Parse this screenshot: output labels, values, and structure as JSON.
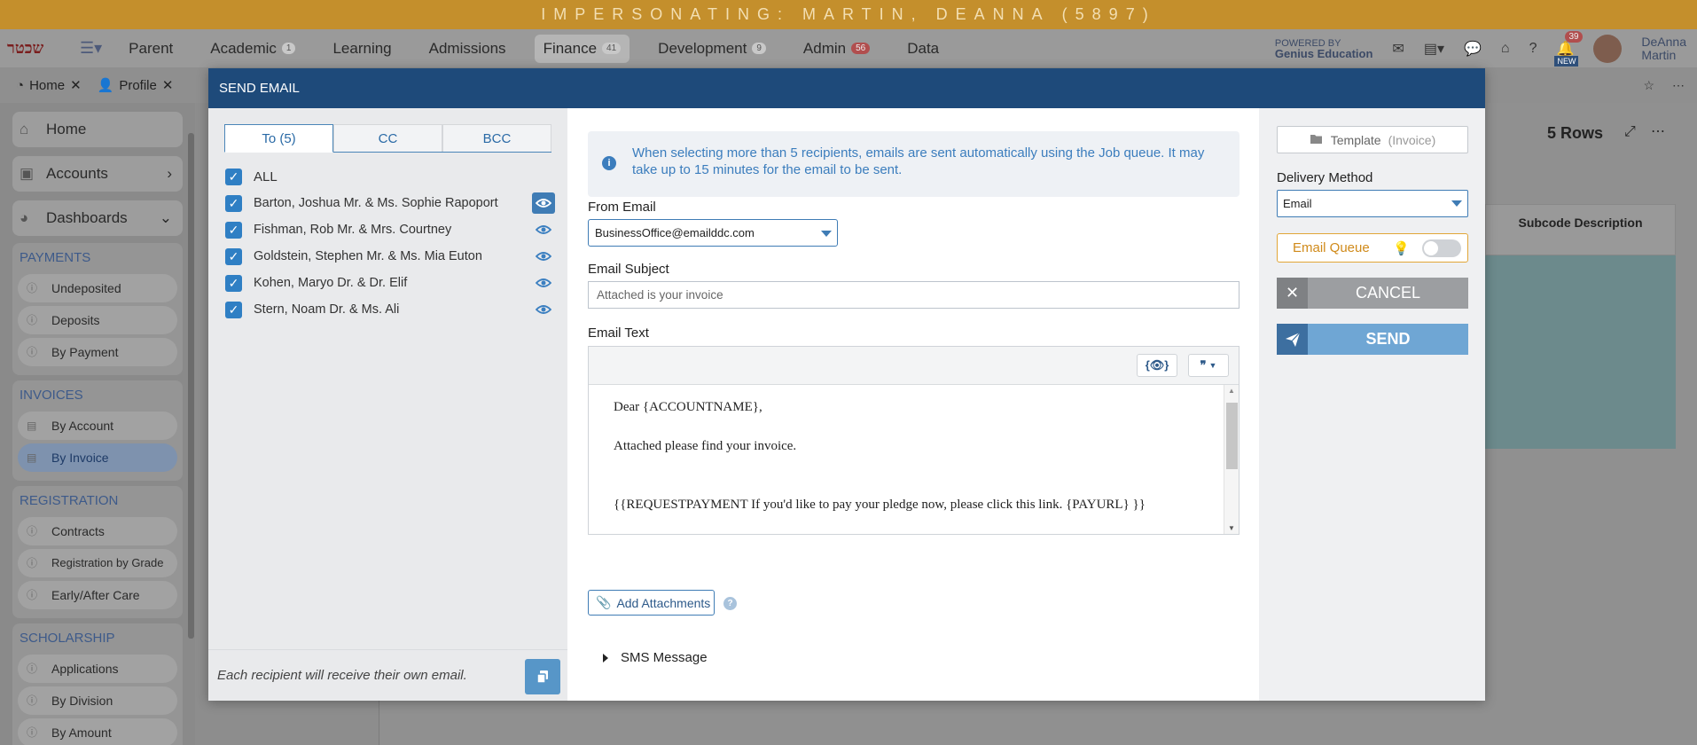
{
  "app": {
    "banner": "IMPERSONATING: MARTIN, DEANNA (5897)",
    "logo_text": "שכטר",
    "nav": [
      {
        "label": "Parent",
        "badge": ""
      },
      {
        "label": "Academic",
        "badge": "1"
      },
      {
        "label": "Learning",
        "badge": ""
      },
      {
        "label": "Admissions",
        "badge": ""
      },
      {
        "label": "Finance",
        "badge": "41"
      },
      {
        "label": "Development",
        "badge": "9"
      },
      {
        "label": "Admin",
        "badge": "56"
      },
      {
        "label": "Data",
        "badge": ""
      }
    ],
    "powered_by": "POWERED BY",
    "powered_brand": "Genius Education",
    "bell_badge": "39",
    "new_badge": "NEW",
    "user_first": "DeAnna",
    "user_last": "Martin",
    "tabs": [
      {
        "label": "Home"
      },
      {
        "label": "Profile"
      }
    ],
    "sidebar": {
      "home": "Home",
      "accounts": "Accounts",
      "dashboards": "Dashboards",
      "groups": [
        {
          "title": "PAYMENTS",
          "items": [
            "Undeposited",
            "Deposits",
            "By Payment"
          ]
        },
        {
          "title": "INVOICES",
          "items": [
            "By Account",
            "By Invoice"
          ]
        },
        {
          "title": "REGISTRATION",
          "items": [
            "Contracts",
            "Registration by Grade",
            "Early/After Care"
          ]
        },
        {
          "title": "SCHOLARSHIP",
          "items": [
            "Applications",
            "By Division",
            "By Amount"
          ]
        }
      ]
    },
    "rows_label": "5 Rows",
    "grid_header": "Subcode Description"
  },
  "modal": {
    "title": "SEND EMAIL",
    "tabs": [
      "To (5)",
      "CC",
      "BCC"
    ],
    "all_label": "ALL",
    "recipients": [
      "Barton, Joshua Mr. & Ms. Sophie Rapoport",
      "Fishman, Rob Mr. & Mrs. Courtney",
      "Goldstein, Stephen Mr. & Ms. Mia Euton",
      "Kohen, Maryo Dr. & Dr. Elif",
      "Stern, Noam Dr. & Ms. Ali"
    ],
    "footer_note": "Each recipient will receive their own email.",
    "info_text": "When selecting more than 5 recipients, emails are sent automatically using the Job queue. It may take up to 15 minutes for the email to be sent.",
    "from_label": "From Email",
    "from_value": "BusinessOffice@emailddc.com",
    "subject_label": "Email Subject",
    "subject_value": "Attached is your invoice",
    "text_label": "Email Text",
    "toolbar_preview": "{👁}",
    "toolbar_quote": "❞",
    "body_lines": [
      "Dear {ACCOUNTNAME},",
      "Attached please find your invoice.",
      "{{REQUESTPAYMENT If you'd like to pay your pledge now, please click this link. {PAYURL} }}"
    ],
    "add_attachments": "Add Attachments",
    "sms_label": "SMS Message",
    "template_label": "Template",
    "template_type": "(Invoice)",
    "delivery_label": "Delivery Method",
    "delivery_value": "Email",
    "queue_label": "Email Queue",
    "queue_on": false,
    "cancel_label": "CANCEL",
    "send_label": "SEND"
  }
}
